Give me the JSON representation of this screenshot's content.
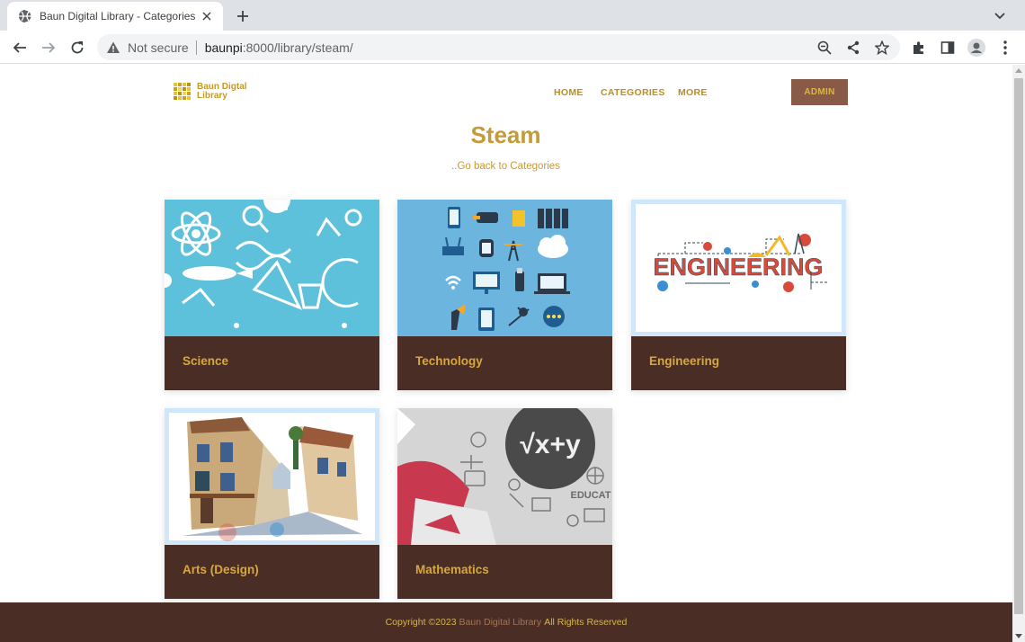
{
  "browser": {
    "tab_title": "Baun Digital Library - Categories",
    "security_label": "Not secure",
    "url_host": "baunpi",
    "url_rest": ":8000/library/steam/"
  },
  "site": {
    "logo_line1": "Baun Digtal",
    "logo_line2": "Library",
    "nav": [
      "HOME",
      "CATEGORIES",
      "MORE"
    ],
    "admin_label": "ADMIN",
    "page_title": "Steam",
    "back_link": "..Go back to Categories"
  },
  "categories": [
    {
      "label": "Science",
      "image": "science-illustration"
    },
    {
      "label": "Technology",
      "image": "technology-icons"
    },
    {
      "label": "Engineering",
      "image": "engineering-banner",
      "image_text": "ENGINEERING"
    },
    {
      "label": "Arts (Design)",
      "image": "watercolor-street"
    },
    {
      "label": "Mathematics",
      "image": "math-collage",
      "image_text": "√x+y"
    }
  ],
  "footer": {
    "prefix": "Copyright ©2023",
    "brand": "Baun Digital Library",
    "suffix": "All Rights Reserved"
  },
  "colors": {
    "brand_gold": "#c59a3a",
    "card_brown": "#4a2e26",
    "admin_bg": "#8a5a49"
  }
}
